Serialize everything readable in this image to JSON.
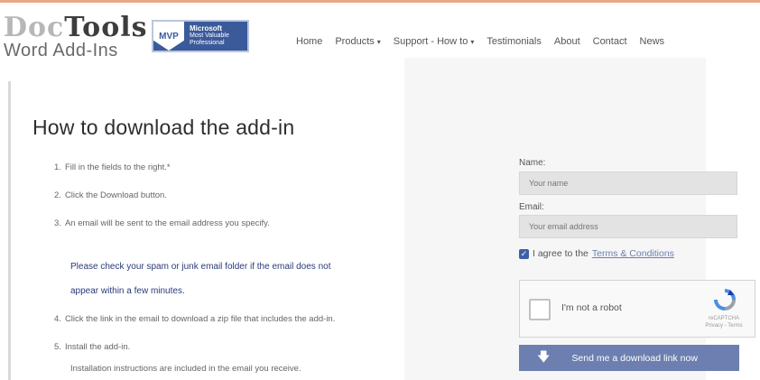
{
  "brand": {
    "logo_prefix": "Doc",
    "logo_highlight": "Tools",
    "logo_subtitle": "Word Add-Ins",
    "badge_short": "MVP",
    "badge_line1": "Microsoft",
    "badge_line2": "Most Valuable",
    "badge_line3": "Professional"
  },
  "nav": {
    "items": [
      {
        "label": "Home"
      },
      {
        "label": "Products",
        "caret": "▾"
      },
      {
        "label": "Support - How to",
        "caret": "▾"
      },
      {
        "label": "Testimonials"
      },
      {
        "label": "About"
      },
      {
        "label": "Contact"
      },
      {
        "label": "News"
      }
    ]
  },
  "page": {
    "title": "How to download the add-in",
    "steps": [
      {
        "num": "1.",
        "text": "Fill in the fields to the right.*"
      },
      {
        "num": "2.",
        "text": "Click the Download button."
      },
      {
        "num": "3.",
        "text": "An email will be sent to the email address you specify."
      },
      {
        "num": "4.",
        "text": "Click the link in the email to download a zip file that includes the add-in."
      },
      {
        "num": "5.",
        "text": "Install the add-in."
      }
    ],
    "notice_line1": "Please check your spam or junk email folder if the email does not",
    "notice_line2": "appear within a few minutes.",
    "install_note": "Installation instructions are included in the email you receive."
  },
  "form": {
    "name_label": "Name:",
    "name_placeholder": "Your name",
    "email_label": "Email:",
    "email_placeholder": "Your email address",
    "agree_text": "I agree to the",
    "terms_link": "Terms & Conditions",
    "recaptcha_label": "I'm not a robot",
    "recaptcha_brand": "reCAPTCHA",
    "recaptcha_links": "Privacy - Terms",
    "submit_label": "Send me a download link now"
  },
  "colors": {
    "accent": "#e8a987",
    "button": "#6c7fb0",
    "notice": "#2a3a7a"
  }
}
